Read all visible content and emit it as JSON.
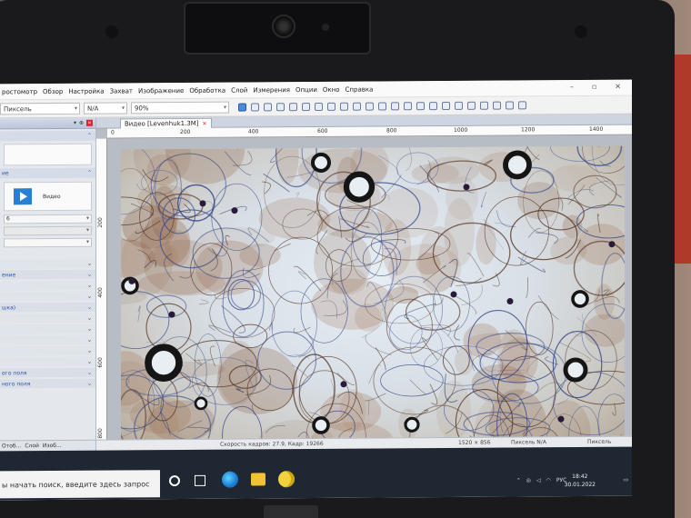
{
  "menubar": {
    "items": [
      "ростомотр",
      "Обзор",
      "Настройка",
      "Захват",
      "Изображение",
      "Обработка",
      "Слой",
      "Измерения",
      "Опции",
      "Окно",
      "Справка"
    ]
  },
  "toolbar": {
    "units_label": "Пиксель",
    "magnification": "N/A",
    "zoom": "90%"
  },
  "left_panel": {
    "video_label": "Видео",
    "sections": [
      "ие",
      "ение",
      "шка)",
      "ого поля",
      "ного поля"
    ],
    "tabs": [
      "Отоб...",
      "Слой",
      "Изоб..."
    ]
  },
  "document": {
    "tab_title": "Видео [Levenhuk1.3M]",
    "ruler_top": [
      "0",
      "200",
      "400",
      "600",
      "800",
      "1000",
      "1200",
      "1400"
    ],
    "ruler_left": [
      "200",
      "400",
      "600",
      "800"
    ]
  },
  "status": {
    "fps_frame": "Скорость кадров: 27.9, Кадр: 19266",
    "resolution": "1520 × 856",
    "pixel": "Пиксель N/A",
    "unit": "Пиксель"
  },
  "taskbar": {
    "search_placeholder": "ы начать поиск, введите здесь запрос",
    "lang": "РУС",
    "time": "18:42",
    "date": "30.01.2022"
  },
  "colors": {
    "accent": "#2b7fd0",
    "taskbar": "#1f2732"
  }
}
